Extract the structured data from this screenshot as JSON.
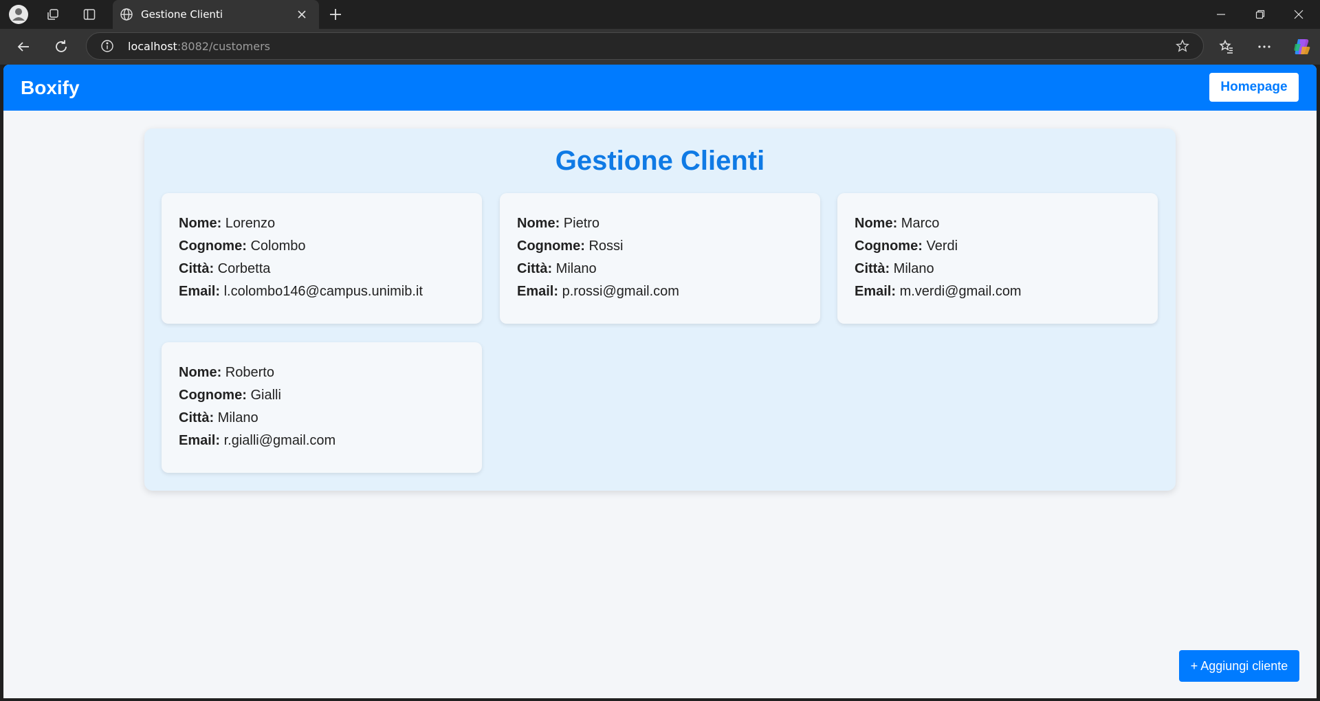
{
  "browser": {
    "tab_title": "Gestione Clienti",
    "url_host": "localhost",
    "url_rest": ":8082/customers"
  },
  "app": {
    "brand": "Boxify",
    "homepage_label": "Homepage"
  },
  "page": {
    "title": "Gestione Clienti",
    "add_button_label": "+ Aggiungi cliente"
  },
  "field_labels": {
    "nome": "Nome:",
    "cognome": "Cognome:",
    "citta": "Città:",
    "email": "Email:"
  },
  "customers": [
    {
      "nome": "Lorenzo",
      "cognome": "Colombo",
      "citta": "Corbetta",
      "email": "l.colombo146@campus.unimib.it"
    },
    {
      "nome": "Pietro",
      "cognome": "Rossi",
      "citta": "Milano",
      "email": "p.rossi@gmail.com"
    },
    {
      "nome": "Marco",
      "cognome": "Verdi",
      "citta": "Milano",
      "email": "m.verdi@gmail.com"
    },
    {
      "nome": "Roberto",
      "cognome": "Gialli",
      "citta": "Milano",
      "email": "r.gialli@gmail.com"
    }
  ],
  "colors": {
    "accent": "#007bff",
    "title": "#0f7ae5",
    "panel_bg": "#e3f1fc",
    "card_bg": "#f5f8fb",
    "page_bg": "#f4f6f9"
  }
}
